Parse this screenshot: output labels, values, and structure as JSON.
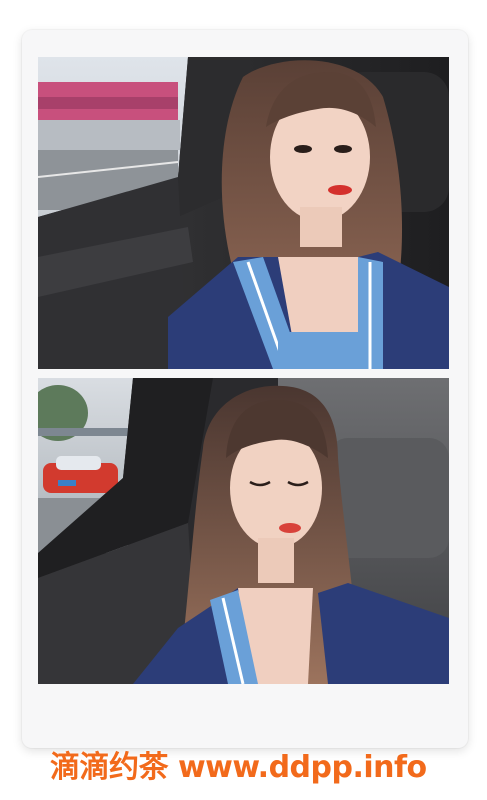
{
  "watermark": {
    "text": "滴滴约茶 www.ddpp.info",
    "color": "#f26a1b"
  },
  "photos": [
    {
      "subject": "woman in car selfie, eyes open, navy cardigan with light blue trim"
    },
    {
      "subject": "woman in car selfie, eyes closed, navy cardigan with light blue trim"
    }
  ]
}
